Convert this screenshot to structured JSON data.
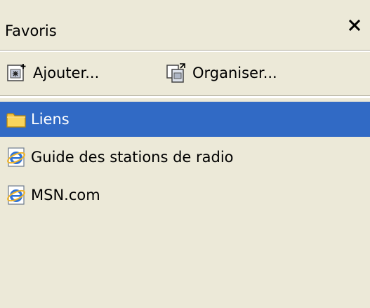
{
  "panel": {
    "title": "Favoris",
    "close_label": "×"
  },
  "toolbar": {
    "add_label": "Ajouter...",
    "organize_label": "Organiser..."
  },
  "favorites": [
    {
      "label": "Liens",
      "icon": "folder-icon",
      "selected": true
    },
    {
      "label": "Guide des stations de radio",
      "icon": "ie-page-icon",
      "selected": false
    },
    {
      "label": "MSN.com",
      "icon": "ie-page-icon",
      "selected": false
    }
  ],
  "colors": {
    "background": "#ECE9D8",
    "selection": "#316AC5",
    "selection_text": "#FFFFFF",
    "text": "#000000"
  }
}
